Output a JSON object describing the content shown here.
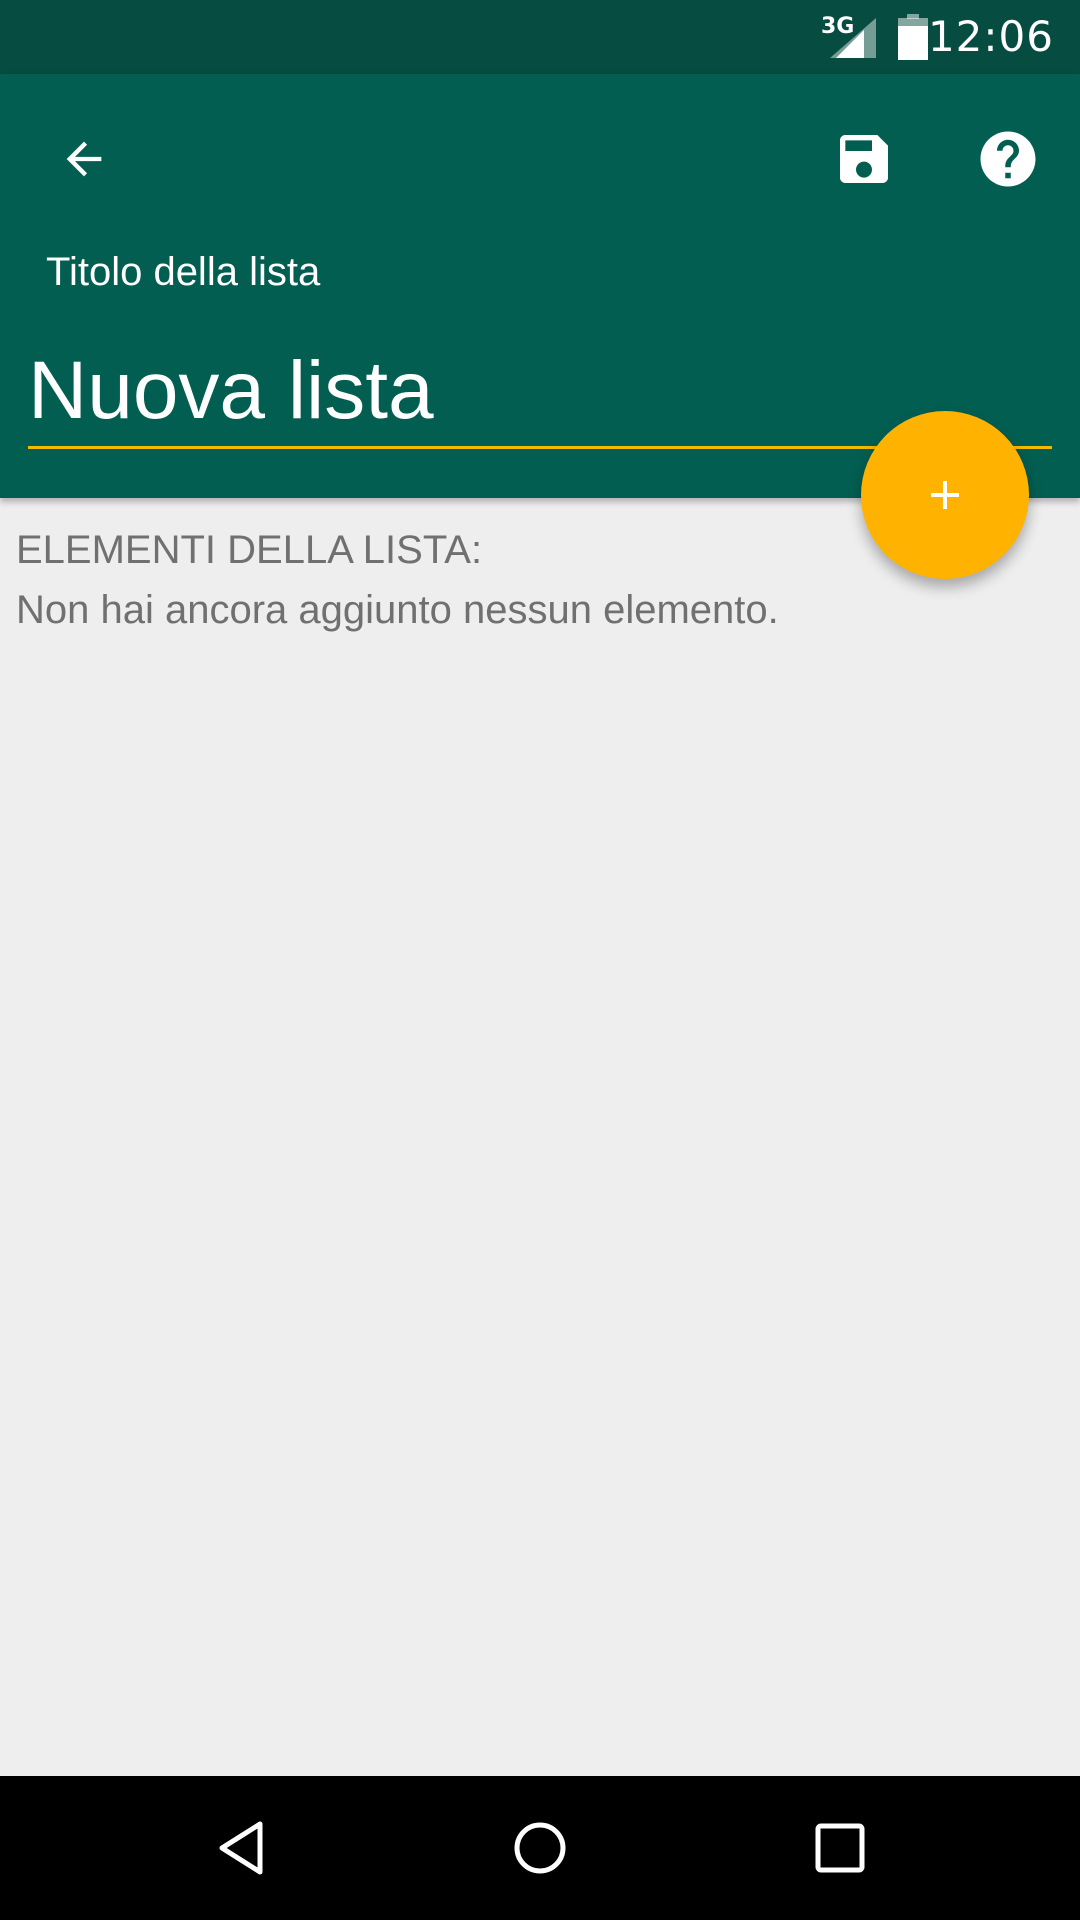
{
  "status_bar": {
    "network": "3G",
    "time": "12:06"
  },
  "app_bar": {
    "back_icon": "arrow-left-icon",
    "save_icon": "save-icon",
    "help_icon": "help-circle-icon",
    "title_label": "Titolo della lista",
    "title_value": "Nuova lista"
  },
  "fab": {
    "icon": "plus-icon"
  },
  "content": {
    "section_header": "ELEMENTI DELLA LISTA:",
    "empty_message": "Non hai ancora aggiunto nessun elemento."
  },
  "nav_bar": {
    "back_icon": "nav-back-icon",
    "home_icon": "nav-home-icon",
    "recents_icon": "nav-recents-icon"
  },
  "colors": {
    "status_bar": "#074c40",
    "app_bar": "#035e52",
    "accent": "#ffb300",
    "background": "#eeeeee",
    "text_secondary": "#707070"
  }
}
